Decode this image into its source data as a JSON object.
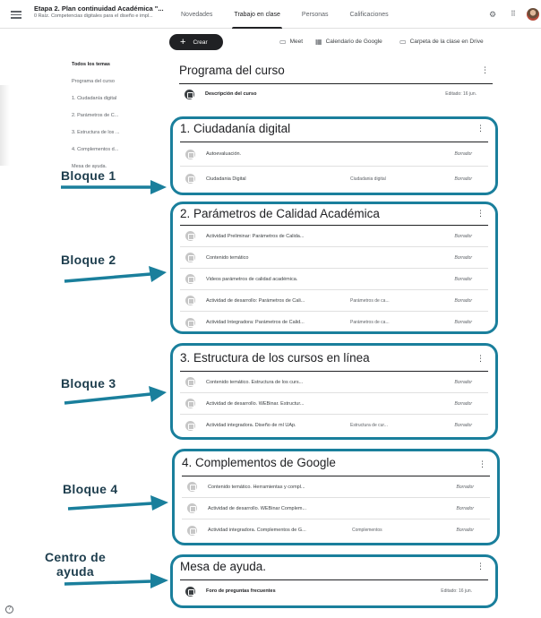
{
  "header": {
    "class_title": "Etapa 2. Plan continuidad Académica \"...",
    "class_subtitle": "0 Raíz. Competencias digitales para el diseño e impl...",
    "tabs": [
      {
        "label": "Novedades",
        "active": false
      },
      {
        "label": "Trabajo en clase",
        "active": true
      },
      {
        "label": "Personas",
        "active": false
      },
      {
        "label": "Calificaciones",
        "active": false
      }
    ],
    "icons": [
      "menu-icon",
      "gear-icon",
      "apps-icon",
      "avatar"
    ]
  },
  "toolbar": {
    "create_label": "Crear",
    "meet_label": "Meet",
    "calendar_label": "Calendario de Google",
    "drive_label": "Carpeta de la clase en Drive"
  },
  "sidebar": {
    "items": [
      {
        "label": "Todos los temas",
        "active": true
      },
      {
        "label": "Programa del curso",
        "active": false
      },
      {
        "label": "1. Ciudadanía digital",
        "active": false
      },
      {
        "label": "2. Parámetros de C...",
        "active": false
      },
      {
        "label": "3. Estructura de los ...",
        "active": false
      },
      {
        "label": "4. Complementos d...",
        "active": false
      },
      {
        "label": "Mesa de ayuda.",
        "active": false
      }
    ]
  },
  "topics": [
    {
      "title": "Programa del curso",
      "items": [
        {
          "title": "Descripción del curso",
          "topic": "",
          "status": "Editado: 16 jun."
        }
      ]
    },
    {
      "title": "1. Ciudadanía digital",
      "items": [
        {
          "title": "Autoevaluación.",
          "topic": "",
          "status": "Borrador"
        },
        {
          "title": "Ciudadania Digital",
          "topic": "Ciudadania digital",
          "status": "Borrador"
        }
      ]
    },
    {
      "title": "2. Parámetros de Calidad Académica",
      "items": [
        {
          "title": "Actividad Preliminar: Parámetros de Calida...",
          "topic": "",
          "status": "Borrador"
        },
        {
          "title": "Contenido temático",
          "topic": "",
          "status": "Borrador"
        },
        {
          "title": "Videos parámetros de calidad académica.",
          "topic": "",
          "status": "Borrador"
        },
        {
          "title": "Actividad de desarrollo: Parámetros de Cali...",
          "topic": "Parámetros de ca...",
          "status": "Borrador"
        },
        {
          "title": "Actividad Integradora: Parámetros de Calid...",
          "topic": "Parámetros de ca...",
          "status": "Borrador"
        }
      ]
    },
    {
      "title": "3. Estructura de los cursos en línea",
      "items": [
        {
          "title": "Contenido temático. Estructura de los curs...",
          "topic": "",
          "status": "Borrador"
        },
        {
          "title": "Actividad de desarrollo. WEBinar. Estructur...",
          "topic": "",
          "status": "Borrador"
        },
        {
          "title": "Actividad integradora. Diseño de ml UAp.",
          "topic": "Estructura de cur...",
          "status": "Borrador"
        }
      ]
    },
    {
      "title": "4. Complementos de Google",
      "items": [
        {
          "title": "Contenido temático. Herramientas y compl...",
          "topic": "",
          "status": "Borrador"
        },
        {
          "title": "Actividad de desarrollo. WEBinar Complem...",
          "topic": "",
          "status": "Borrador"
        },
        {
          "title": "Actividad integradora. Complementos de G...",
          "topic": "Complementos",
          "status": "Borrador"
        }
      ]
    },
    {
      "title": "Mesa de ayuda.",
      "items": [
        {
          "title": "Foro de preguntas frecuentes",
          "topic": "",
          "status": "Editado: 16 jun."
        }
      ]
    }
  ],
  "annotations": {
    "bloque1": "Bloque 1",
    "bloque2": "Bloque 2",
    "bloque3": "Bloque 3",
    "bloque4": "Bloque 4",
    "centro_line1": "Centro de",
    "centro_line2": "ayuda",
    "accent_color": "#1a7f9c",
    "arrow_color": "#1a7f9c"
  }
}
